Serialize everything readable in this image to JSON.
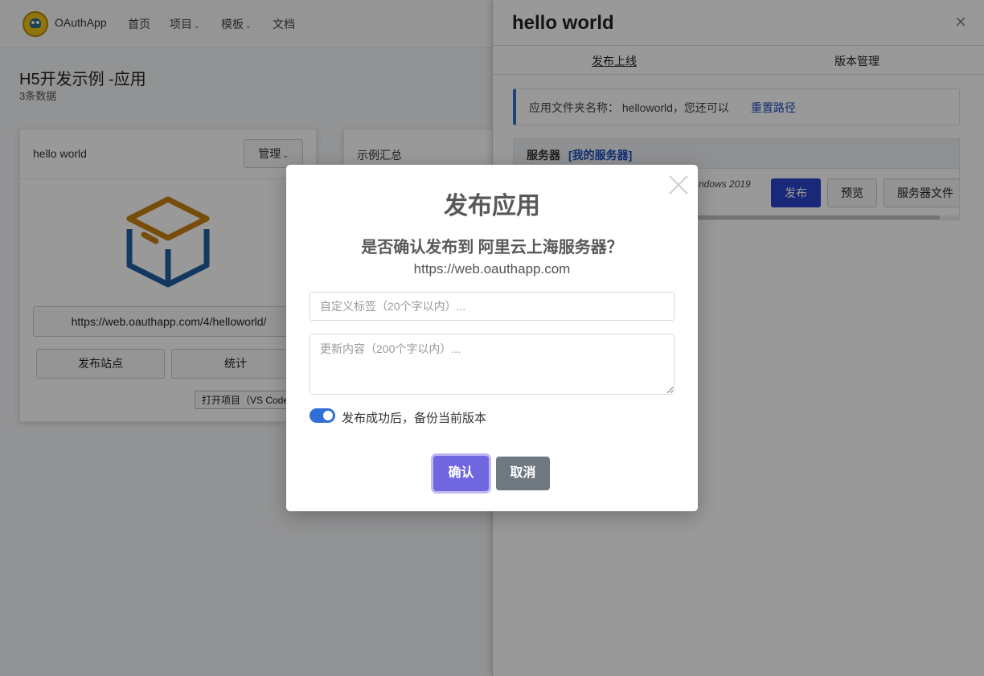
{
  "navbar": {
    "brand": "OAuthApp",
    "items": [
      "首页",
      "项目",
      "模板",
      "文档"
    ],
    "caret": "⌄"
  },
  "page": {
    "title": "H5开发示例 -应用",
    "subtitle": "3条数据"
  },
  "card1": {
    "title": "hello world",
    "manage": "管理",
    "url": "https://web.oauthapp.com/4/helloworld/",
    "publish_site": "发布站点",
    "stats": "统计",
    "open_project": "打开项目（VS Code"
  },
  "card2": {
    "title": "示例汇总"
  },
  "panel": {
    "title": "hello world",
    "close": "×",
    "tabs": [
      "发布上线",
      "版本管理"
    ],
    "folder_text": "应用文件夹名称： helloworld，您还可以",
    "reset_link": "重置路径",
    "server_label": "服务器",
    "my_servers": "[我的服务器]",
    "server_os": "ndows 2019",
    "publish": "发布",
    "preview": "预览",
    "server_files": "服务器文件"
  },
  "modal": {
    "title": "发布应用",
    "question": "是否确认发布到 阿里云上海服务器？",
    "url": "https://web.oauthapp.com",
    "tag_placeholder": "自定义标签（20个字以内）...",
    "content_placeholder": "更新内容（200个字以内）...",
    "backup_label": "发布成功后，备份当前版本",
    "backup_enabled": true,
    "confirm": "确认",
    "cancel": "取消"
  },
  "colors": {
    "primary": "#2a43c8",
    "confirm": "#7066e0",
    "cancel": "#6e7881",
    "link": "#1a4dbb",
    "toggle": "#2f6fd6"
  }
}
